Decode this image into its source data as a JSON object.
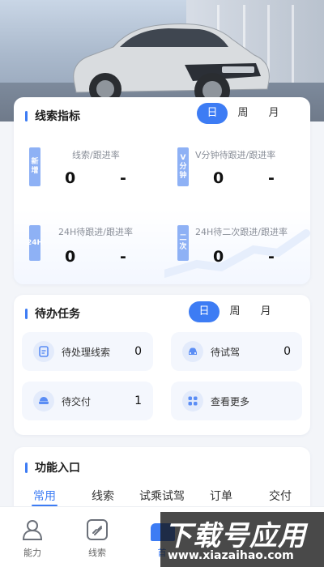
{
  "indicators": {
    "title": "线索指标",
    "range_tabs": [
      "日",
      "周",
      "月"
    ],
    "active_range": "日",
    "cells": [
      {
        "tag": "新增",
        "label": "线索/跟进率",
        "value": "0",
        "rate": "-"
      },
      {
        "tag": "V分钟",
        "label": "V分钟待跟进/跟进率",
        "value": "0",
        "rate": "-"
      },
      {
        "tag": "24H",
        "label": "24H待跟进/跟进率",
        "value": "0",
        "rate": "-"
      },
      {
        "tag": "二次",
        "label": "24H待二次跟进/跟进率",
        "value": "0",
        "rate": "-"
      }
    ]
  },
  "todo": {
    "title": "待办任务",
    "range_tabs": [
      "日",
      "周",
      "月"
    ],
    "active_range": "日",
    "items": [
      {
        "label": "待处理线索",
        "count": "0",
        "icon": "clipboard-icon"
      },
      {
        "label": "待试驾",
        "count": "0",
        "icon": "car-icon"
      },
      {
        "label": "待交付",
        "count": "1",
        "icon": "delivery-icon"
      },
      {
        "label": "查看更多",
        "count": "",
        "icon": "grid-icon"
      }
    ]
  },
  "functions": {
    "title": "功能入口",
    "tabs": [
      "常用",
      "线索",
      "试乘试驾",
      "订单",
      "交付"
    ],
    "active_tab": "常用"
  },
  "bottom_nav": {
    "items": [
      {
        "label": "能力",
        "icon": "person-icon"
      },
      {
        "label": "线索",
        "icon": "clue-icon"
      },
      {
        "label": "首",
        "icon": "home-icon"
      }
    ]
  },
  "watermark": {
    "big": "下载号应用",
    "small": "www.xiazaihao.com"
  },
  "colors": {
    "accent": "#3d7cf4",
    "tag": "#8eb1f5",
    "tile_bg": "#f4f7fd"
  }
}
